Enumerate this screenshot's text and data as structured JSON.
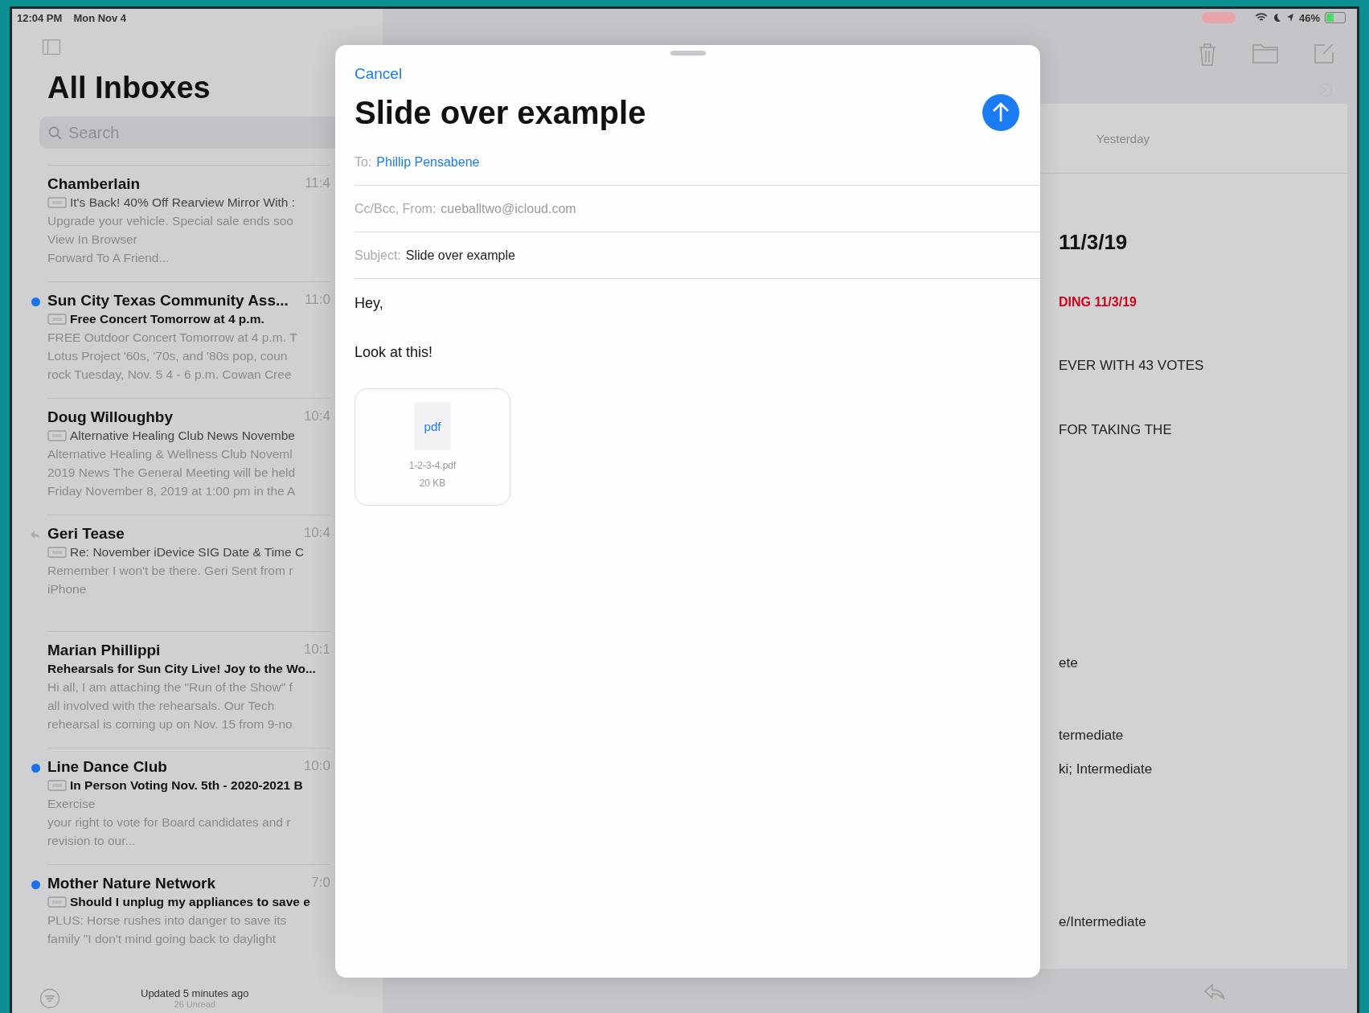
{
  "status_bar": {
    "time": "12:04 PM",
    "date": "Mon Nov 4",
    "battery": "46%"
  },
  "mailbox": {
    "title": "All Inboxes",
    "search": {
      "placeholder": "Search"
    },
    "messages": [
      {
        "sender": "Chamberlain",
        "time": "11:4",
        "subject": "It's Back! 40% Off Rearview Mirror With :",
        "preview": [
          "Upgrade your vehicle. Special sale ends soo",
          "View In Browser",
          "Forward To A Friend..."
        ],
        "unread": false,
        "replied": false,
        "thread_icon": true
      },
      {
        "sender": "Sun City Texas Community Ass...",
        "time": "11:0",
        "subject": "Free Concert Tomorrow at 4 p.m.",
        "preview": [
          "FREE Outdoor Concert Tomorrow at 4 p.m. T",
          "Lotus Project '60s, '70s, and '80s pop, coun",
          "rock Tuesday, Nov. 5 4 - 6 p.m. Cowan Cree"
        ],
        "unread": true,
        "replied": false,
        "thread_icon": true
      },
      {
        "sender": "Doug Willoughby",
        "time": "10:4",
        "subject": "Alternative Healing Club News Novembe",
        "preview": [
          "Alternative Healing & Wellness Club Noveml",
          "2019 News The General Meeting will be held",
          "Friday November 8, 2019 at 1:00 pm in the A"
        ],
        "unread": false,
        "replied": false,
        "thread_icon": true
      },
      {
        "sender": "Geri Tease",
        "time": "10:4",
        "subject": "Re: November iDevice SIG Date & Time C",
        "preview": [
          "Remember I won't be there. Geri Sent from r",
          "iPhone"
        ],
        "unread": false,
        "replied": true,
        "thread_icon": true
      },
      {
        "sender": "Marian Phillippi",
        "time": "10:1",
        "subject": "Rehearsals for Sun City Live! Joy to the Wo...",
        "preview": [
          "Hi all, I am attaching the \"Run of the Show\" f",
          "all involved with the rehearsals. Our Tech",
          "rehearsal is coming up on Nov. 15 from 9-no"
        ],
        "unread": false,
        "replied": false,
        "thread_icon": false
      },
      {
        "sender": "Line Dance Club",
        "time": "10:0",
        "subject": "In Person Voting Nov. 5th - 2020-2021 B",
        "preview": [
          "Exercise",
          "your right to vote for Board candidates and r",
          "revision to our..."
        ],
        "unread": true,
        "replied": false,
        "thread_icon": true
      },
      {
        "sender": "Mother Nature Network",
        "time": "7:0",
        "subject": "Should I unplug my appliances to save e",
        "preview": [
          "PLUS: Horse rushes into danger to save its",
          "family \"I don't mind going back to daylight"
        ],
        "unread": true,
        "replied": false,
        "thread_icon": true
      }
    ],
    "footer": {
      "updated": "Updated 5 minutes ago",
      "unread": "26 Unread"
    }
  },
  "detail": {
    "header_date": "Yesterday",
    "lines": [
      {
        "text": "11/3/19",
        "kind": "heading"
      },
      {
        "text": "DING 11/3/19",
        "kind": "alert"
      },
      {
        "text": "EVER WITH 43 VOTES",
        "kind": "plain"
      },
      {
        "text": "FOR TAKING THE",
        "kind": "plain"
      },
      {
        "text": "ete",
        "kind": "plain"
      },
      {
        "text": "termediate",
        "kind": "plain"
      },
      {
        "text": "ki; Intermediate",
        "kind": "plain"
      },
      {
        "text": "e/Intermediate",
        "kind": "plain"
      }
    ]
  },
  "compose": {
    "cancel": "Cancel",
    "title": "Slide over example",
    "to": {
      "label": "To:",
      "value": "Phillip Pensabene"
    },
    "from": {
      "label": "Cc/Bcc, From:",
      "value": "cueballtwo@icloud.com"
    },
    "subject": {
      "label": "Subject:",
      "value": "Slide over example"
    },
    "body": [
      "Hey,",
      "Look at this!"
    ],
    "attachment": {
      "type": "pdf",
      "name": "1-2-3-4.pdf",
      "size": "20 KB"
    }
  }
}
